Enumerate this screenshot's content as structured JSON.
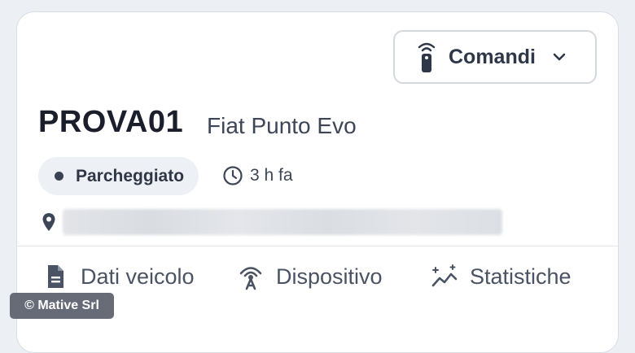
{
  "header": {
    "commands_label": "Comandi",
    "commands_icon": "remote-control-icon",
    "dropdown_icon": "chevron-down-icon"
  },
  "vehicle": {
    "plate": "PROVA01",
    "model": "Fiat Punto Evo"
  },
  "status": {
    "label": "Parcheggiato",
    "elapsed": "3 h fa",
    "elapsed_icon": "clock-icon"
  },
  "location": {
    "icon": "map-pin-icon",
    "address": ""
  },
  "tabs": [
    {
      "label": "Dati veicolo",
      "icon": "document-icon"
    },
    {
      "label": "Dispositivo",
      "icon": "signal-antenna-icon"
    },
    {
      "label": "Statistiche",
      "icon": "chart-sparkle-icon"
    }
  ],
  "watermark": "© Mative Srl",
  "colors": {
    "background": "#eceff4",
    "card": "#ffffff",
    "text_primary": "#1a1f2b",
    "text_secondary": "#4a5363",
    "pill_bg": "#edf0f5",
    "border": "#d3d8e0"
  }
}
